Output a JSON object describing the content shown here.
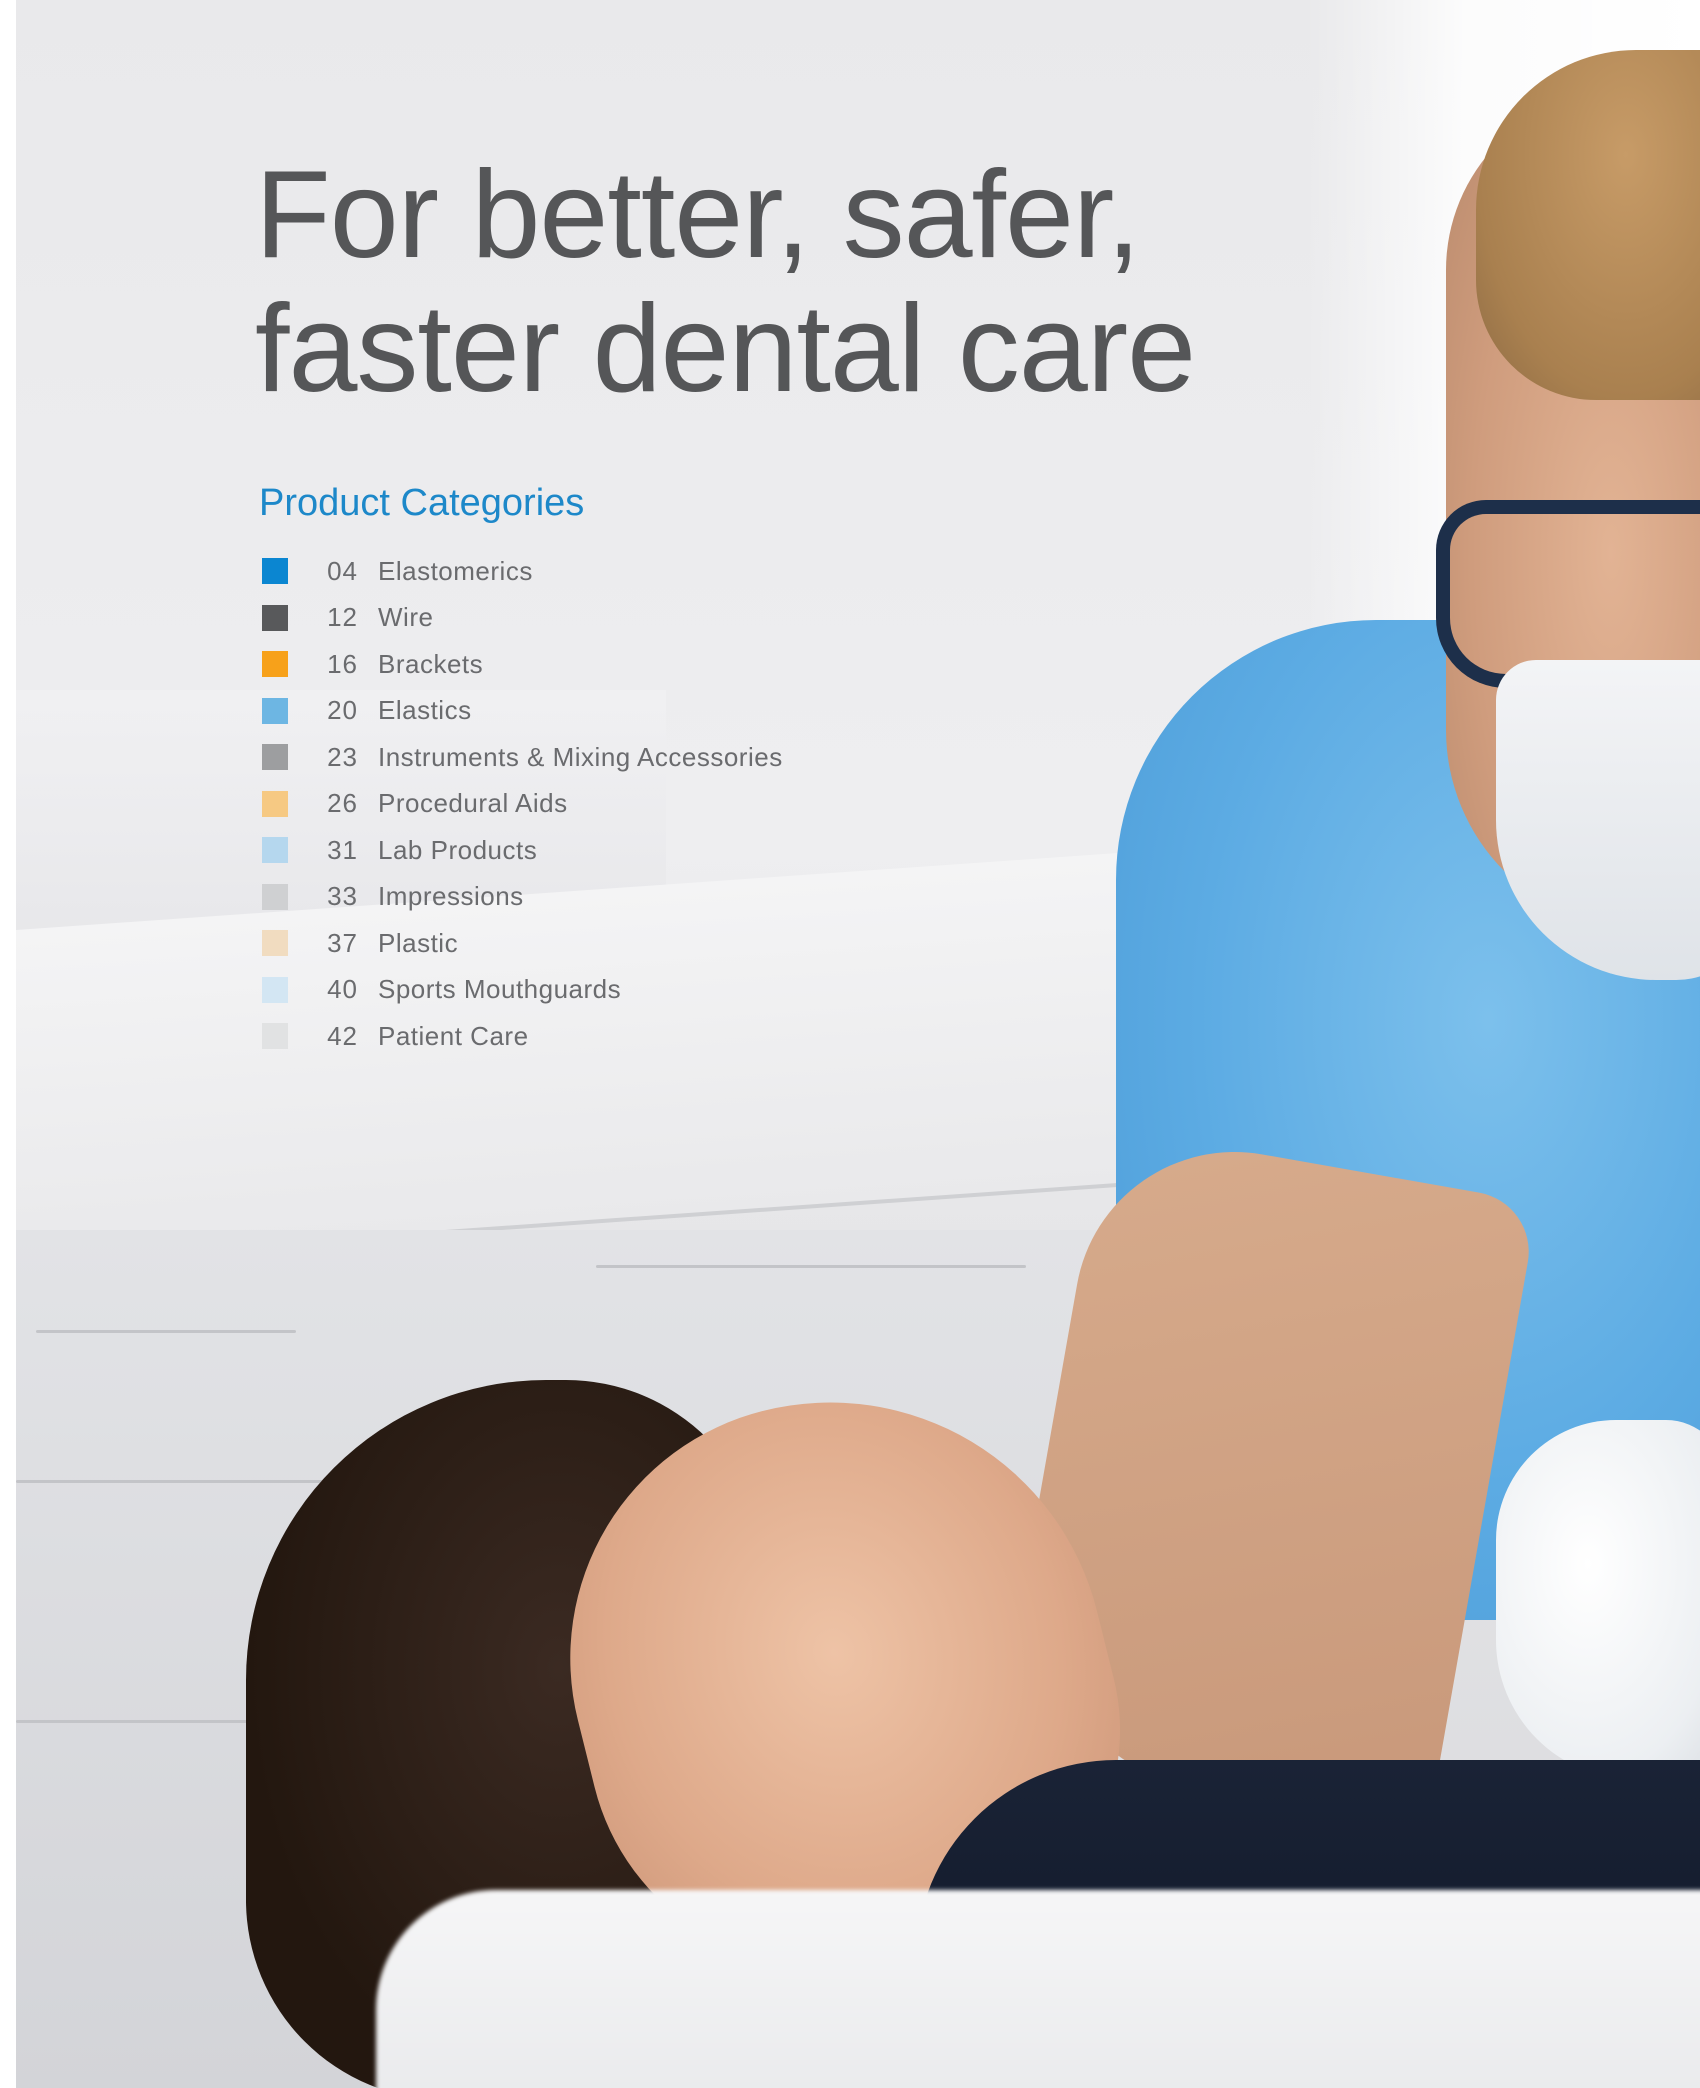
{
  "headline": "For better, safer,\nfaster dental care",
  "categories": {
    "title": "Product Categories",
    "items": [
      {
        "page": "04",
        "label": "Elastomerics",
        "color": "#0b86d1"
      },
      {
        "page": "12",
        "label": "Wire",
        "color": "#58595b"
      },
      {
        "page": "16",
        "label": "Brackets",
        "color": "#f7a11a"
      },
      {
        "page": "20",
        "label": "Elastics",
        "color": "#6db6e3"
      },
      {
        "page": "23",
        "label": "Instruments & Mixing Accessories",
        "color": "#9d9e a0"
      },
      {
        "page": "26",
        "label": "Procedural Aids",
        "color": "#f6c983"
      },
      {
        "page": "31",
        "label": "Lab Products",
        "color": "#b5d7ee"
      },
      {
        "page": "33",
        "label": "Impressions",
        "color": "#cfd0d2"
      },
      {
        "page": "37",
        "label": "Plastic",
        "color": "#f1dcc0"
      },
      {
        "page": "40",
        "label": "Sports Mouthguards",
        "color": "#d3e6f3"
      },
      {
        "page": "42",
        "label": "Patient Care",
        "color": "#e1e2e3"
      }
    ]
  }
}
